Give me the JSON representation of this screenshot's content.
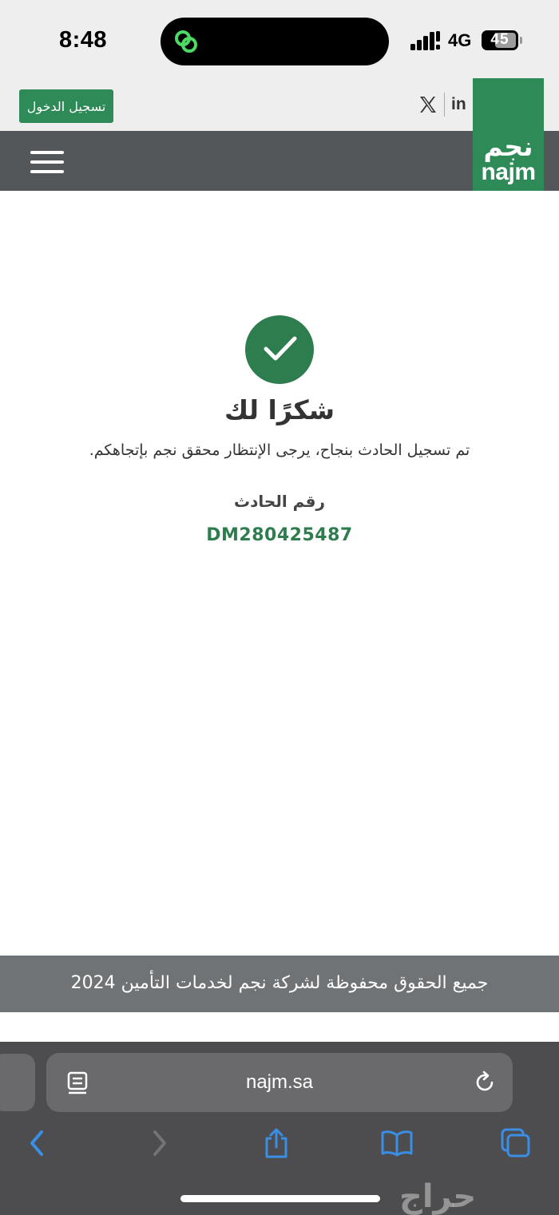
{
  "status_bar": {
    "time": "8:48",
    "network": "4G",
    "battery": "45",
    "icons": [
      "link-app-icon",
      "signal-icon",
      "battery-icon"
    ]
  },
  "header": {
    "login_label": "تسجيل الدخول",
    "social": {
      "x_icon": "x-icon",
      "linkedin_label": "in"
    },
    "logo_ar": "نجم",
    "logo_en": "najm",
    "menu_icon": "hamburger-menu-icon"
  },
  "main": {
    "success_icon": "checkmark-icon",
    "title": "شكرًا لك",
    "message": "تم تسجيل الحادث بنجاح، يرجى الإنتظار محقق نجم بإتجاهكم.",
    "accident_label": "رقم الحادث",
    "accident_number": "DM280425487"
  },
  "footer": {
    "copyright": "جميع الحقوق محفوظة لشركة نجم لخدمات التأمين 2024"
  },
  "browser": {
    "url": "najm.sa",
    "icons": [
      "reader-icon",
      "reload-icon",
      "back-icon",
      "forward-icon",
      "share-icon",
      "bookmarks-icon",
      "tabs-icon"
    ]
  },
  "watermark": "حراج",
  "colors": {
    "brand_green": "#2e8b57",
    "nav_gray": "#53575a",
    "footer_gray": "#707375",
    "browser_accent": "#3a8ee6"
  }
}
